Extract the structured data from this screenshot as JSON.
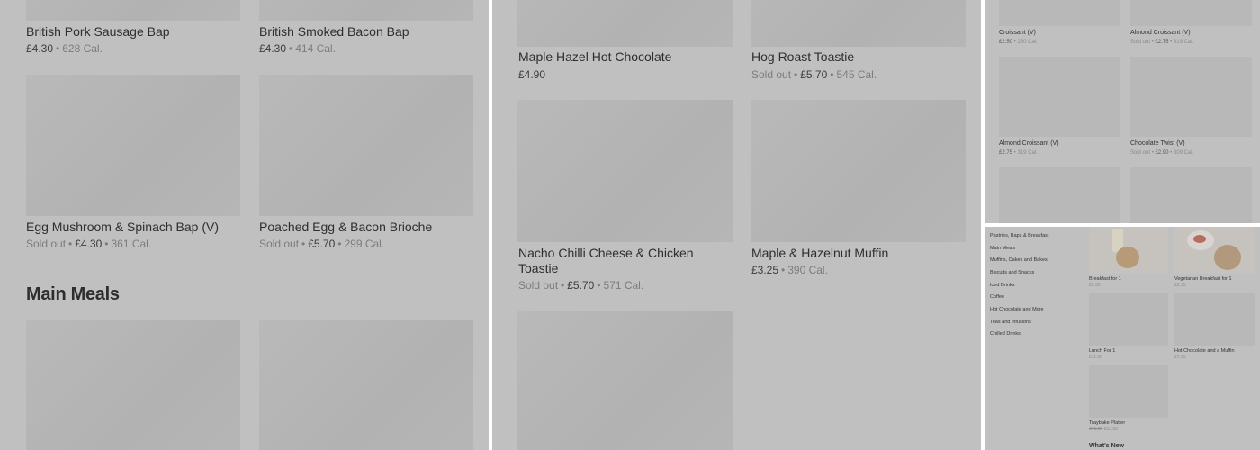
{
  "panel1": {
    "items": [
      {
        "name": "British Pork Sausage Bap",
        "sold_out": "",
        "price": "£4.30",
        "cal": "628 Cal."
      },
      {
        "name": "British Smoked Bacon Bap",
        "sold_out": "",
        "price": "£4.30",
        "cal": "414 Cal."
      },
      {
        "name": "Egg Mushroom & Spinach Bap (V)",
        "sold_out": "Sold out",
        "price": "£4.30",
        "cal": "361 Cal."
      },
      {
        "name": "Poached Egg & Bacon Brioche",
        "sold_out": "Sold out",
        "price": "£5.70",
        "cal": "299 Cal."
      }
    ],
    "section_title": "Main Meals"
  },
  "panel2": {
    "items": [
      {
        "name": "Maple Hazel Hot Chocolate",
        "sold_out": "",
        "price": "£4.90",
        "cal": ""
      },
      {
        "name": "Hog Roast Toastie",
        "sold_out": "Sold out",
        "price": "£5.70",
        "cal": "545 Cal."
      },
      {
        "name": "Nacho Chilli Cheese & Chicken Toastie",
        "sold_out": "Sold out",
        "price": "£5.70",
        "cal": "571 Cal."
      },
      {
        "name": "Maple & Hazelnut Muffin",
        "sold_out": "",
        "price": "£3.25",
        "cal": "390 Cal."
      }
    ]
  },
  "panel3": {
    "items": [
      {
        "name": "Croissant (V)",
        "sold_out": "",
        "price": "£2.50",
        "cal": "250 Cal."
      },
      {
        "name": "Almond Croissant (V)",
        "sold_out": "Sold out",
        "price": "£2.75",
        "cal": "319 Cal."
      },
      {
        "name": "Almond Croissant (V)",
        "sold_out": "",
        "price": "£2.75",
        "cal": "319 Cal."
      },
      {
        "name": "Chocolate Twist (V)",
        "sold_out": "Sold out",
        "price": "£2.90",
        "cal": "309 Cal."
      }
    ]
  },
  "panel4": {
    "categories": [
      "Pastries, Baps & Breakfast",
      "Main Meals",
      "Muffins, Cakes and Bakes",
      "Biscuits and Snacks",
      "Iced Drinks",
      "Coffee",
      "Hot Chocolate and More",
      "Teas and Infusions",
      "Chilled Drinks"
    ],
    "items": [
      {
        "name": "Breakfast for 1",
        "price": "£9.35"
      },
      {
        "name": "Vegetarian Breakfast for 1",
        "price": "£9.35"
      },
      {
        "name": "Lunch For 1",
        "price": "£11.00"
      },
      {
        "name": "Hot Chocolate and a Muffin",
        "price": "£7.35"
      },
      {
        "name": "Traybake Platter",
        "price": "£13.00",
        "old_price": "£16.00"
      }
    ],
    "whats_new": "What's New"
  }
}
